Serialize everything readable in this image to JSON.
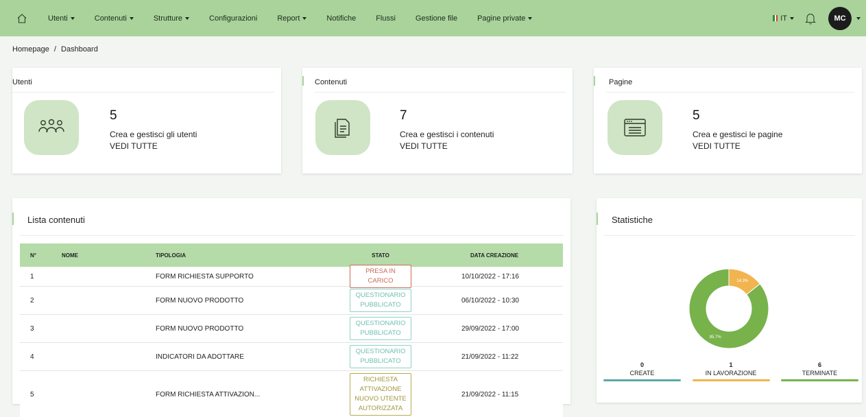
{
  "nav": {
    "items": [
      {
        "label": "Utenti",
        "dropdown": true
      },
      {
        "label": "Contenuti",
        "dropdown": true
      },
      {
        "label": "Strutture",
        "dropdown": true
      },
      {
        "label": "Configurazioni",
        "dropdown": false
      },
      {
        "label": "Report",
        "dropdown": true
      },
      {
        "label": "Notifiche",
        "dropdown": false
      },
      {
        "label": "Flussi",
        "dropdown": false
      },
      {
        "label": "Gestione file",
        "dropdown": false
      },
      {
        "label": "Pagine private",
        "dropdown": true
      }
    ],
    "language": "IT",
    "avatar_initials": "MC"
  },
  "breadcrumb": {
    "home": "Homepage",
    "separator": "/",
    "current": "Dashboard"
  },
  "cards": [
    {
      "title": "Utenti",
      "count": "5",
      "description": "Crea e gestisci gli utenti",
      "link": "VEDI TUTTE",
      "icon": "users-icon"
    },
    {
      "title": "Contenuti",
      "count": "7",
      "description": "Crea e gestisci i contenuti",
      "link": "VEDI TUTTE",
      "icon": "document-icon"
    },
    {
      "title": "Pagine",
      "count": "5",
      "description": "Crea e gestisci le pagine",
      "link": "VEDI TUTTE",
      "icon": "browser-page-icon"
    }
  ],
  "content_list": {
    "title": "Lista contenuti",
    "columns": [
      "N°",
      "NOME",
      "TIPOLOGIA",
      "STATO",
      "DATA CREAZIONE"
    ],
    "rows": [
      {
        "n": "1",
        "nome": "",
        "tipologia": "FORM RICHIESTA SUPPORTO",
        "stato": "PRESA IN CARICO",
        "stato_kind": "presa",
        "data": "10/10/2022 - 17:16"
      },
      {
        "n": "2",
        "nome": "",
        "tipologia": "FORM NUOVO PRODOTTO",
        "stato": "QUESTIONARIO PUBBLICATO",
        "stato_kind": "quest",
        "data": "06/10/2022 - 10:30"
      },
      {
        "n": "3",
        "nome": "",
        "tipologia": "FORM NUOVO PRODOTTO",
        "stato": "QUESTIONARIO PUBBLICATO",
        "stato_kind": "quest",
        "data": "29/09/2022 - 17:00"
      },
      {
        "n": "4",
        "nome": "",
        "tipologia": "INDICATORI DA ADOTTARE",
        "stato": "QUESTIONARIO PUBBLICATO",
        "stato_kind": "quest",
        "data": "21/09/2022 - 11:22"
      },
      {
        "n": "5",
        "nome": "",
        "tipologia": "FORM RICHIESTA ATTIVAZION...",
        "stato": "RICHIESTA ATTIVAZIONE NUOVO UTENTE AUTORIZZATA",
        "stato_kind": "rich",
        "data": "21/09/2022 - 11:15"
      }
    ]
  },
  "statistics": {
    "title": "Statistiche",
    "slices": [
      {
        "label": "14.3%",
        "value": 14.3,
        "color": "#f2b44f"
      },
      {
        "label": "85.7%",
        "value": 85.7,
        "color": "#77b24b"
      }
    ],
    "legend": [
      {
        "value": "0",
        "label": "CREATE",
        "color": "#5aa9a9"
      },
      {
        "value": "1",
        "label": "IN LAVORAZIONE",
        "color": "#f2b44f"
      },
      {
        "value": "6",
        "label": "TERMINATE",
        "color": "#77b24b"
      }
    ]
  },
  "colors": {
    "topbar": "#a9d39b",
    "accent_green": "#77b24b",
    "icon_bg": "#cfe5c5"
  }
}
